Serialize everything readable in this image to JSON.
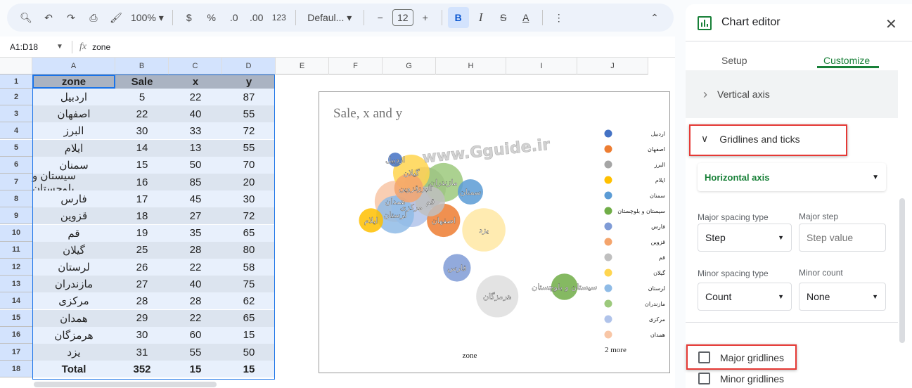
{
  "toolbar": {
    "zoom": "100%",
    "currency": "$",
    "percent": "%",
    "dec_decrease": ".0",
    "dec_increase": ".00",
    "format": "123",
    "font": "Defaul...",
    "font_size": "12",
    "bold": "B",
    "italic": "I",
    "strike": "S",
    "text_color": "A"
  },
  "formula_bar": {
    "range": "A1:D18",
    "fx": "fx",
    "value": "zone"
  },
  "columns": [
    "A",
    "B",
    "C",
    "D",
    "E",
    "F",
    "G",
    "H",
    "I",
    "J"
  ],
  "table": {
    "headers": [
      "zone",
      "Sale",
      "x",
      "y"
    ],
    "rows": [
      [
        "اردبیل",
        "5",
        "22",
        "87"
      ],
      [
        "اصفهان",
        "22",
        "40",
        "55"
      ],
      [
        "البرز",
        "30",
        "33",
        "72"
      ],
      [
        "ایلام",
        "14",
        "13",
        "55"
      ],
      [
        "سمنان",
        "15",
        "50",
        "70"
      ],
      [
        "سیستان و بلوچستان",
        "16",
        "85",
        "20"
      ],
      [
        "فارس",
        "17",
        "45",
        "30"
      ],
      [
        "قزوین",
        "18",
        "27",
        "72"
      ],
      [
        "قم",
        "19",
        "35",
        "65"
      ],
      [
        "گیلان",
        "25",
        "28",
        "80"
      ],
      [
        "لرستان",
        "26",
        "22",
        "58"
      ],
      [
        "مازندران",
        "27",
        "40",
        "75"
      ],
      [
        "مرکزی",
        "28",
        "28",
        "62"
      ],
      [
        "همدان",
        "29",
        "22",
        "65"
      ],
      [
        "هرمزگان",
        "30",
        "60",
        "15"
      ],
      [
        "یزد",
        "31",
        "55",
        "50"
      ],
      [
        "Total",
        "352",
        "15",
        "15"
      ]
    ]
  },
  "chart_data": {
    "type": "bubble",
    "title": "Sale, x and y",
    "xlabel": "zone",
    "ylabel": "",
    "grid": false,
    "legend": "right",
    "legend_more": "2 more",
    "watermark": "www.Gguide.ir",
    "series": [
      {
        "name": "اردبیل",
        "x": 22,
        "y": 87,
        "size": 5,
        "color": "#4472c4"
      },
      {
        "name": "اصفهان",
        "x": 40,
        "y": 55,
        "size": 22,
        "color": "#ed7d31"
      },
      {
        "name": "البرز",
        "x": 33,
        "y": 72,
        "size": 30,
        "color": "#a5a5a5"
      },
      {
        "name": "ایلام",
        "x": 13,
        "y": 55,
        "size": 14,
        "color": "#ffc000"
      },
      {
        "name": "سمنان",
        "x": 50,
        "y": 70,
        "size": 15,
        "color": "#5b9bd5"
      },
      {
        "name": "سیستان و بلوچستان",
        "x": 85,
        "y": 20,
        "size": 16,
        "color": "#70ad47"
      },
      {
        "name": "فارس",
        "x": 45,
        "y": 30,
        "size": 17,
        "color": "#7f9bd6"
      },
      {
        "name": "قزوین",
        "x": 27,
        "y": 72,
        "size": 18,
        "color": "#f4a46c"
      },
      {
        "name": "قم",
        "x": 35,
        "y": 65,
        "size": 19,
        "color": "#bfbfbf"
      },
      {
        "name": "گیلان",
        "x": 28,
        "y": 80,
        "size": 25,
        "color": "#ffd54f"
      },
      {
        "name": "لرستان",
        "x": 22,
        "y": 58,
        "size": 26,
        "color": "#8fbbe6"
      },
      {
        "name": "مازندران",
        "x": 40,
        "y": 75,
        "size": 27,
        "color": "#9cc97c"
      },
      {
        "name": "مرکزی",
        "x": 28,
        "y": 62,
        "size": 28,
        "color": "#b0c3ea"
      },
      {
        "name": "همدان",
        "x": 22,
        "y": 65,
        "size": 29,
        "color": "#f8c6a6"
      },
      {
        "name": "هرمزگان",
        "x": 60,
        "y": 15,
        "size": 30,
        "color": "#dedede"
      },
      {
        "name": "یزد",
        "x": 55,
        "y": 50,
        "size": 31,
        "color": "#ffe8a3"
      }
    ]
  },
  "editor": {
    "title": "Chart editor",
    "tabs": [
      "Setup",
      "Customize"
    ],
    "active_tab": "Customize",
    "accent": "#188038",
    "vertical_axis": "Vertical axis",
    "gridlines_section": "Gridlines and ticks",
    "axis_select": "Horizontal axis",
    "major_spacing_label": "Major spacing type",
    "major_spacing_value": "Step",
    "major_step_label": "Major step",
    "major_step_placeholder": "Step value",
    "minor_spacing_label": "Minor spacing type",
    "minor_spacing_value": "Count",
    "minor_count_label": "Minor count",
    "minor_count_value": "None",
    "major_gridlines": "Major gridlines",
    "minor_gridlines": "Minor gridlines",
    "major_checked": false,
    "minor_checked": false
  }
}
